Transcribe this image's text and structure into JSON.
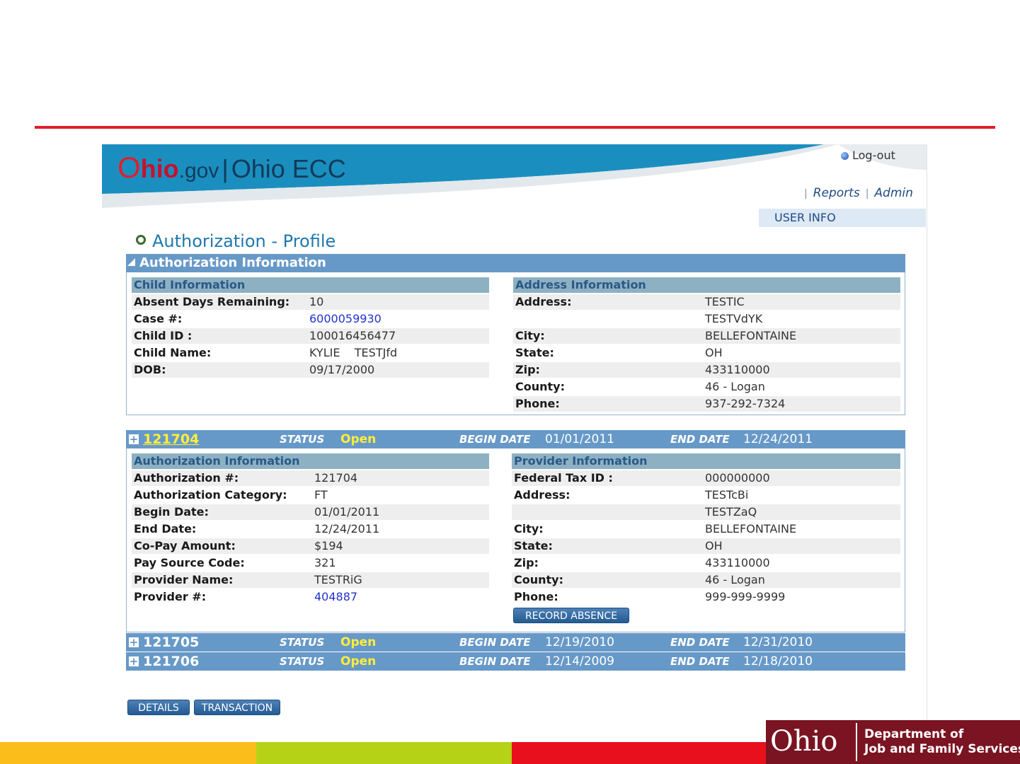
{
  "header": {
    "brand_o": "O",
    "brand_hio": "hio",
    "brand_gov": ".gov",
    "brand_sep": "|",
    "brand_app": "Ohio ECC",
    "logout": "Log-out",
    "links": [
      "Reports",
      "Admin"
    ],
    "user_info": "USER INFO"
  },
  "page_title": "Authorization - Profile",
  "auth_info_panel": {
    "title": "Authorization Information",
    "child": {
      "title": "Child Information",
      "rows": [
        {
          "label": "Absent Days Remaining:",
          "value": "10"
        },
        {
          "label": "Case #:",
          "value": "6000059930"
        },
        {
          "label": "Child ID :",
          "value": "100016456477"
        },
        {
          "label": "Child Name:",
          "value": "KYLIE    TESTJfd"
        },
        {
          "label": "DOB:",
          "value": "09/17/2000"
        }
      ]
    },
    "address": {
      "title": "Address Information",
      "rows": [
        {
          "label": "Address:",
          "value": "TESTIC"
        },
        {
          "label": "",
          "value": "TESTVdYK"
        },
        {
          "label": "City:",
          "value": "BELLEFONTAINE"
        },
        {
          "label": "State:",
          "value": "OH"
        },
        {
          "label": "Zip:",
          "value": "433110000"
        },
        {
          "label": "County:",
          "value": "46 - Logan"
        },
        {
          "label": "Phone:",
          "value": "937-292-7324"
        }
      ]
    }
  },
  "authorizations": [
    {
      "number": "121704",
      "status_label": "STATUS",
      "status": "Open",
      "begin_label": "BEGIN DATE",
      "begin": "01/01/2011",
      "end_label": "END DATE",
      "end": "12/24/2011",
      "expanded": true
    },
    {
      "number": "121705",
      "status_label": "STATUS",
      "status": "Open",
      "begin_label": "BEGIN DATE",
      "begin": "12/19/2010",
      "end_label": "END DATE",
      "end": "12/31/2010",
      "expanded": false
    },
    {
      "number": "121706",
      "status_label": "STATUS",
      "status": "Open",
      "begin_label": "BEGIN DATE",
      "begin": "12/14/2009",
      "end_label": "END DATE",
      "end": "12/18/2010",
      "expanded": false
    }
  ],
  "auth_detail": {
    "auth": {
      "title": "Authorization Information",
      "rows": [
        {
          "label": "Authorization #:",
          "value": "121704"
        },
        {
          "label": "Authorization Category:",
          "value": "FT"
        },
        {
          "label": "Begin Date:",
          "value": "01/01/2011"
        },
        {
          "label": "End Date:",
          "value": "12/24/2011"
        },
        {
          "label": "Co-Pay Amount:",
          "value": "$194"
        },
        {
          "label": "Pay Source Code:",
          "value": "321"
        },
        {
          "label": "Provider Name:",
          "value": "TESTRiG"
        },
        {
          "label": "Provider #:",
          "value": "404887"
        }
      ]
    },
    "provider": {
      "title": "Provider Information",
      "rows": [
        {
          "label": "Federal Tax ID :",
          "value": "000000000"
        },
        {
          "label": "Address:",
          "value": "TESTcBi"
        },
        {
          "label": "",
          "value": "TESTZaQ"
        },
        {
          "label": "City:",
          "value": "BELLEFONTAINE"
        },
        {
          "label": "State:",
          "value": "OH"
        },
        {
          "label": "Zip:",
          "value": "433110000"
        },
        {
          "label": "County:",
          "value": "46 - Logan"
        },
        {
          "label": "Phone:",
          "value": "999-999-9999"
        }
      ]
    },
    "record_absence": "RECORD ABSENCE"
  },
  "buttons": {
    "details": "DETAILS",
    "transaction": "TRANSACTION"
  },
  "footer": {
    "ohio": "Ohio",
    "dept_line1": "Department of",
    "dept_line2": "Job and Family Services"
  },
  "colors": {
    "accent_red": "#e31d2b",
    "header_blue": "#6799c8",
    "status_yellow": "#ffee3a",
    "stripe_yellow": "#fbbd1a",
    "stripe_green": "#b5d216",
    "stripe_red": "#e8101c",
    "ojfs_maroon": "#7a1422"
  }
}
